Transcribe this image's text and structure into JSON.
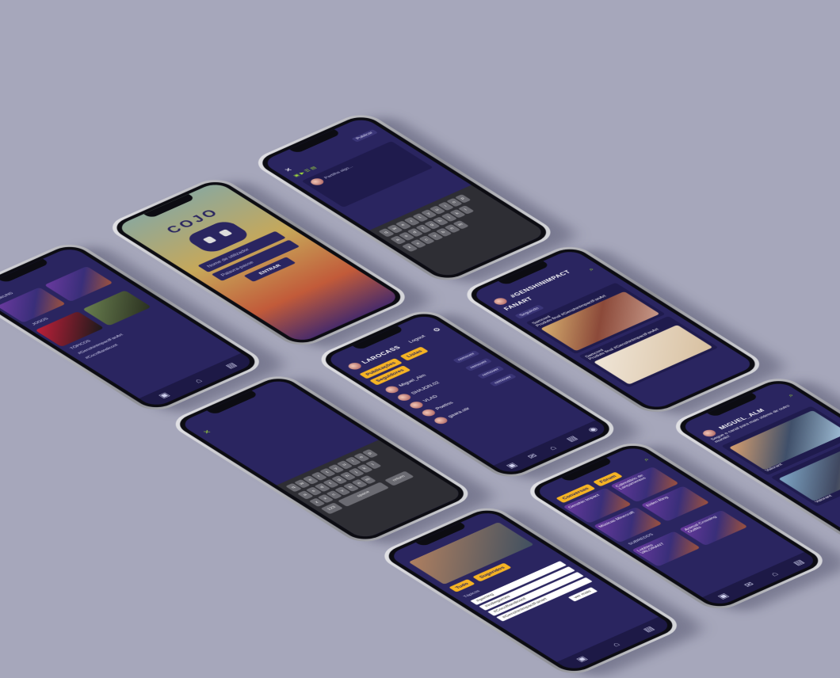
{
  "login": {
    "brand": "COJO",
    "username_placeholder": "Nome de utilizador",
    "password_placeholder": "Palavra-passe",
    "enter": "ENTRAR"
  },
  "profile": {
    "username": "LAROCASS",
    "logout": "Logout",
    "tabs": [
      "Publicações",
      "Listas",
      "Seguidores"
    ],
    "followers": [
      "Miguel_Alm",
      "SHAJON.02",
      "VLAD",
      "Poetiss",
      "gaara.stir"
    ],
    "remove": "remover"
  },
  "forum": {
    "tabs": [
      "Conversas",
      "Fórum"
    ],
    "tiles": [
      "Genshin Impact",
      "Calendário de Lançamentos",
      "Jogos da semana",
      "Elden Ring",
      "Músicas Minecraft",
      "Stardew Valley",
      "Animal Crossing Outfits",
      "Mario Cart Combos",
      "Diablo Pixel",
      "Skyrim magias",
      "Lobbies VALORANT"
    ],
    "section": "SUBREDDS"
  },
  "post": {
    "publish": "Publicar",
    "placeholder": "Partilha algo..."
  },
  "fanart": {
    "title": "#GENSHINIMPACT FANART",
    "follow": "Seguindo",
    "author": "Samcord",
    "caption": "Produto final #GenshinImpactFanArt"
  },
  "channel": {
    "username": "MIGUEL_ALM",
    "bio": "Segue o canal para mais vídeos de outro mundo!",
    "game1": "Valorant",
    "game2": "Valorant"
  },
  "home": {
    "sections": [
      "FÓRUNS",
      "JOGOS",
      "TÓPICOS"
    ],
    "topics": [
      "#GenshinImpactFanArt",
      "#CocoBandicoot",
      "#indiegames",
      "#gaming"
    ]
  },
  "search": {
    "tabs": [
      "Tudo",
      "Sugeridos"
    ],
    "section": "Tópicos",
    "tags": [
      "#gaming",
      "#indiegames",
      "#CocoBandicoot",
      "#GenshinImpactFanart"
    ],
    "more": "ver mais"
  },
  "keyboard": {
    "space": "space",
    "return": "return",
    "numbers": "123"
  },
  "colors": {
    "background": "#a6a7bb",
    "screen": "#2a2560",
    "accent_yellow": "#f5b324",
    "accent_green": "#9bd43c"
  }
}
